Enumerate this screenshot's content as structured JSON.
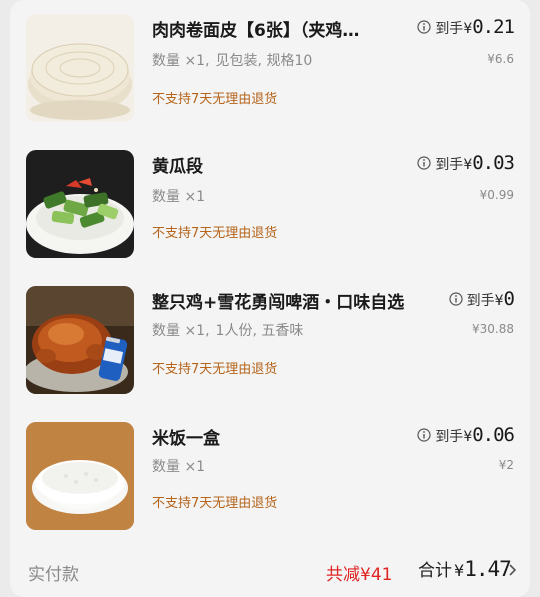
{
  "items": [
    {
      "title": "肉肉卷面皮【6张】（夹鸡…",
      "quantity": "数量 ×1,",
      "spec": "见包装, 规格10",
      "policy": "不支持7天无理由退货",
      "price_label": "到手",
      "currency": "¥",
      "price": "0.21",
      "original_price": "¥6.6",
      "image_icon": "wrap-skins-image"
    },
    {
      "title": "黄瓜段",
      "quantity": "数量 ×1",
      "spec": "",
      "policy": "不支持7天无理由退货",
      "price_label": "到手",
      "currency": "¥",
      "price": "0.03",
      "original_price": "¥0.99",
      "image_icon": "cucumber-image"
    },
    {
      "title": "整只鸡+雪花勇闯啤酒・口味自选",
      "quantity": "数量 ×1,",
      "spec": "1人份, 五香味",
      "policy": "不支持7天无理由退货",
      "price_label": "到手",
      "currency": "¥",
      "price": "0",
      "original_price": "¥30.88",
      "image_icon": "roast-chicken-image"
    },
    {
      "title": "米饭一盒",
      "quantity": "数量 ×1",
      "spec": "",
      "policy": "不支持7天无理由退货",
      "price_label": "到手",
      "currency": "¥",
      "price": "0.06",
      "original_price": "¥2",
      "image_icon": "rice-bowl-image"
    }
  ],
  "footer": {
    "paid_label": "实付款",
    "discount": "共减¥41",
    "total_label": "合计",
    "total_currency": "¥",
    "total_value": "1.47"
  },
  "colors": {
    "policy": "#b5641a",
    "discount": "#e02424",
    "muted": "#8a8a8a"
  }
}
